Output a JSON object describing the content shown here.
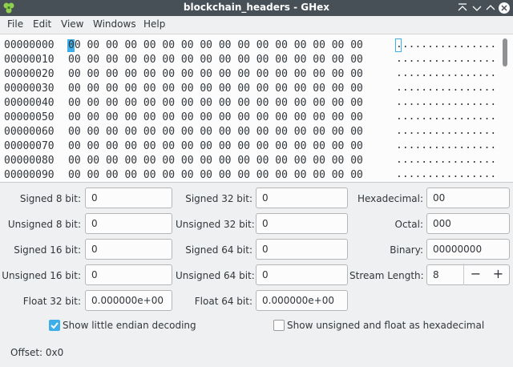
{
  "window": {
    "title": "blockchain_headers - GHex",
    "controls": [
      "keep-above-icon",
      "minimize-icon",
      "maximize-icon",
      "close-icon"
    ]
  },
  "menu": [
    "File",
    "Edit",
    "View",
    "Windows",
    "Help"
  ],
  "hex_view": {
    "rows": [
      {
        "offset": "00000000",
        "bytes": "00 00 00 00 00 00 00 00 00 00 00 00 00 00 00 00",
        "ascii": "................"
      },
      {
        "offset": "00000010",
        "bytes": "00 00 00 00 00 00 00 00 00 00 00 00 00 00 00 00",
        "ascii": "................"
      },
      {
        "offset": "00000020",
        "bytes": "00 00 00 00 00 00 00 00 00 00 00 00 00 00 00 00",
        "ascii": "................"
      },
      {
        "offset": "00000030",
        "bytes": "00 00 00 00 00 00 00 00 00 00 00 00 00 00 00 00",
        "ascii": "................"
      },
      {
        "offset": "00000040",
        "bytes": "00 00 00 00 00 00 00 00 00 00 00 00 00 00 00 00",
        "ascii": "................"
      },
      {
        "offset": "00000050",
        "bytes": "00 00 00 00 00 00 00 00 00 00 00 00 00 00 00 00",
        "ascii": "................"
      },
      {
        "offset": "00000060",
        "bytes": "00 00 00 00 00 00 00 00 00 00 00 00 00 00 00 00",
        "ascii": "................"
      },
      {
        "offset": "00000070",
        "bytes": "00 00 00 00 00 00 00 00 00 00 00 00 00 00 00 00",
        "ascii": "................"
      },
      {
        "offset": "00000080",
        "bytes": "00 00 00 00 00 00 00 00 00 00 00 00 00 00 00 00",
        "ascii": "................"
      },
      {
        "offset": "00000090",
        "bytes": "00 00 00 00 00 00 00 00 00 00 00 00 00 00 00 00",
        "ascii": "................"
      }
    ]
  },
  "converter": {
    "col1": [
      {
        "label": "Signed 8 bit:",
        "value": "0"
      },
      {
        "label": "Unsigned 8 bit:",
        "value": "0"
      },
      {
        "label": "Signed 16 bit:",
        "value": "0"
      },
      {
        "label": "Unsigned 16 bit:",
        "value": "0"
      },
      {
        "label": "Float 32 bit:",
        "value": "0.000000e+00"
      }
    ],
    "col2": [
      {
        "label": "Signed 32 bit:",
        "value": "0"
      },
      {
        "label": "Unsigned 32 bit:",
        "value": "0"
      },
      {
        "label": "Signed 64 bit:",
        "value": "0"
      },
      {
        "label": "Unsigned 64 bit:",
        "value": "0"
      },
      {
        "label": "Float 64 bit:",
        "value": "0.000000e+00"
      }
    ],
    "col3": [
      {
        "label": "Hexadecimal:",
        "value": "00"
      },
      {
        "label": "Octal:",
        "value": "000"
      },
      {
        "label": "Binary:",
        "value": "00000000"
      },
      {
        "label": "Stream Length:",
        "value": "8"
      }
    ],
    "spin": {
      "minus": "−",
      "plus": "+"
    }
  },
  "options": {
    "little_endian": {
      "label": "Show little endian decoding",
      "checked": true
    },
    "unsigned_hex": {
      "label": "Show unsigned and float as hexadecimal",
      "checked": false
    }
  },
  "status": {
    "offset": "Offset: 0x0"
  },
  "colors": {
    "accent": "#3daee9",
    "titlebar": "#475057"
  }
}
